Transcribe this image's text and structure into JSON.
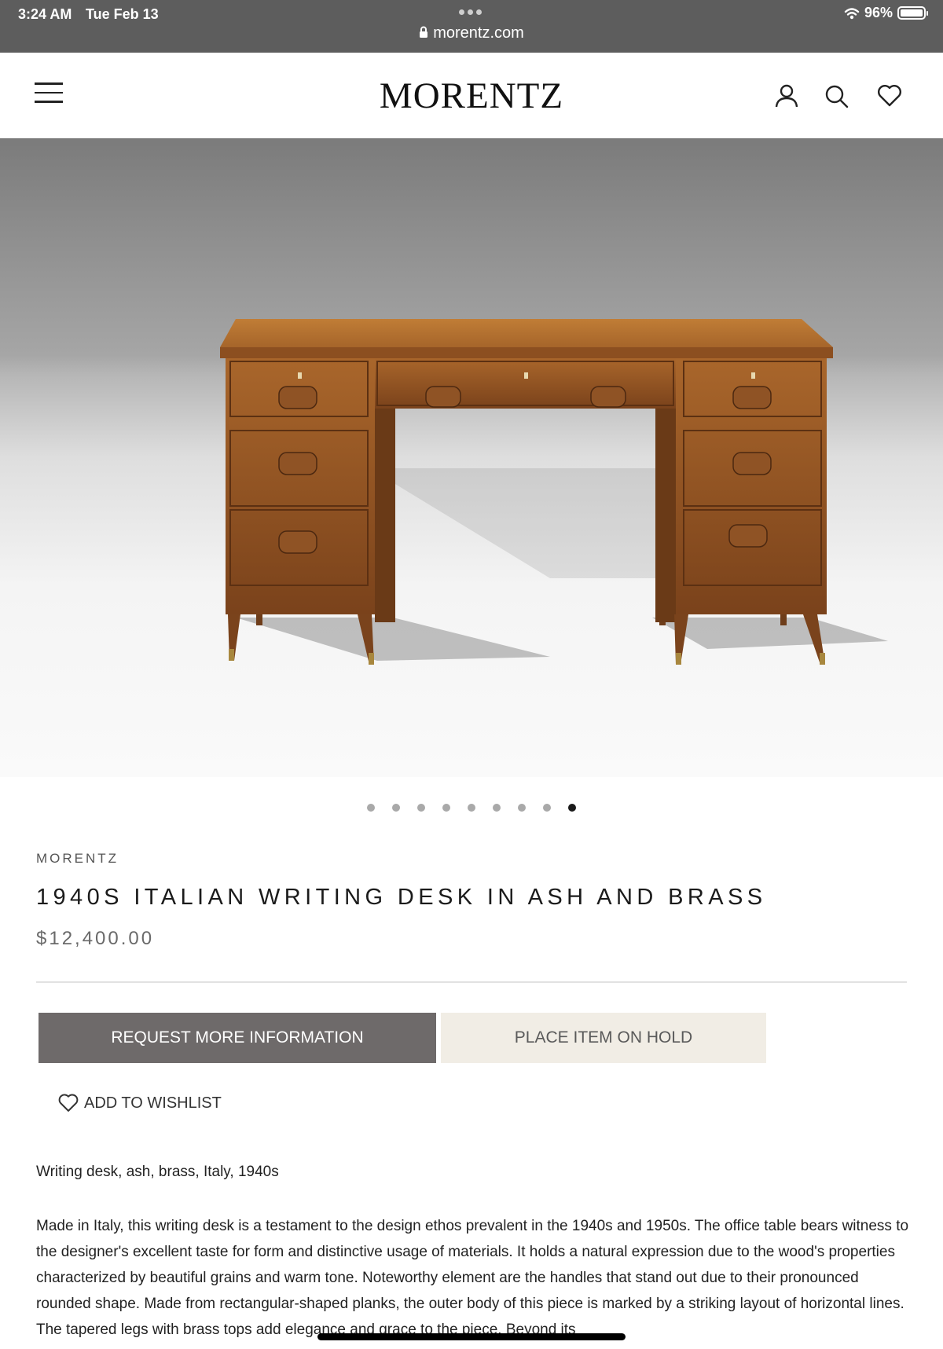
{
  "status_bar": {
    "time": "3:24 AM",
    "date": "Tue Feb 13",
    "url": "morentz.com",
    "battery": "96%",
    "icons": [
      "lock-icon",
      "wifi-icon",
      "battery-icon"
    ]
  },
  "header": {
    "logo": "MORENTZ",
    "icons": [
      "hamburger-menu-icon",
      "account-icon",
      "search-icon",
      "heart-icon"
    ]
  },
  "gallery": {
    "image": "wooden writing desk with drawers on tapered legs",
    "slide_count": 9,
    "active_slide": 9
  },
  "product": {
    "vendor": "MORENTZ",
    "title": "1940S ITALIAN WRITING DESK IN ASH AND BRASS",
    "price": "$12,400.00",
    "request_button": "REQUEST MORE INFORMATION",
    "hold_button": "PLACE ITEM ON HOLD",
    "wishlist_label": "ADD TO WISHLIST",
    "short_description": "Writing desk, ash, brass, Italy, 1940s",
    "description": "Made in Italy, this writing desk is a testament to the design ethos prevalent in the 1940s and 1950s. The office table bears witness to the designer's excellent taste for form and distinctive usage of materials. It holds a natural expression due to the wood's properties characterized by beautiful grains and warm tone. Noteworthy element are the handles that stand out due to their pronounced rounded shape. Made from rectangular-shaped planks, the outer body of this piece is marked by a striking layout of horizontal lines. The tapered legs with brass tops add elegance and grace to the piece. Beyond its"
  },
  "colors": {
    "status_bar_bg": "#5d5d5d",
    "request_button_bg": "#6e6a6a",
    "hold_button_bg": "#f1ede5",
    "wood": "#8a4f22"
  }
}
